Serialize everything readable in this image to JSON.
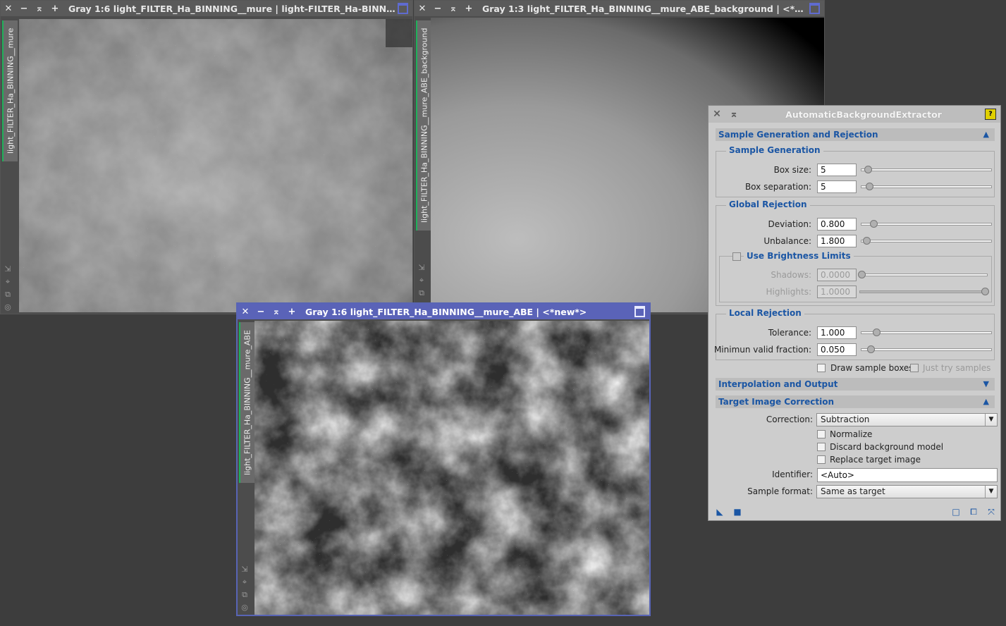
{
  "windows": {
    "left": {
      "title": "Gray 1:6 light_FILTER_Ha_BINNING__mure | light-FILTER_Ha-BINNIN...",
      "side_label": "light_FILTER_Ha_BINNING__mure",
      "buttons": [
        "✕",
        "−",
        "⌅",
        "+"
      ]
    },
    "right": {
      "title": "Gray 1:3 light_FILTER_Ha_BINNING__mure_ABE_background | <*n...",
      "side_label": "light_FILTER_Ha_BINNING__mure_ABE_background",
      "buttons": [
        "✕",
        "−",
        "⌅",
        "+"
      ]
    },
    "front": {
      "title": "Gray 1:6 light_FILTER_Ha_BINNING__mure_ABE | <*new*>",
      "side_label": "light_FILTER_Ha_BINNING__mure_ABE",
      "buttons": [
        "✕",
        "−",
        "⌅",
        "+"
      ]
    }
  },
  "abe": {
    "title": "AutomaticBackgroundExtractor",
    "sections": {
      "sample_gen_rejection": "Sample Generation and Rejection",
      "interpolation_output": "Interpolation and Output",
      "target_correction": "Target Image Correction"
    },
    "sample_generation": {
      "group": "Sample Generation",
      "box_size_label": "Box size:",
      "box_size": "5",
      "box_sep_label": "Box separation:",
      "box_sep": "5"
    },
    "global_rejection": {
      "group": "Global Rejection",
      "deviation_label": "Deviation:",
      "deviation": "0.800",
      "unbalance_label": "Unbalance:",
      "unbalance": "1.800",
      "brightness_limits": "Use Brightness Limits",
      "shadows_label": "Shadows:",
      "shadows": "0.0000",
      "highlights_label": "Highlights:",
      "highlights": "1.0000"
    },
    "local_rejection": {
      "group": "Local Rejection",
      "tolerance_label": "Tolerance:",
      "tolerance": "1.000",
      "min_valid_label": "Minimun valid fraction:",
      "min_valid": "0.050",
      "draw_boxes": "Draw sample boxes",
      "just_try": "Just try samples"
    },
    "target": {
      "correction_label": "Correction:",
      "correction": "Subtraction",
      "normalize": "Normalize",
      "discard": "Discard background model",
      "replace": "Replace target image",
      "identifier_label": "Identifier:",
      "identifier": "<Auto>",
      "sample_format_label": "Sample format:",
      "sample_format": "Same as target"
    }
  }
}
